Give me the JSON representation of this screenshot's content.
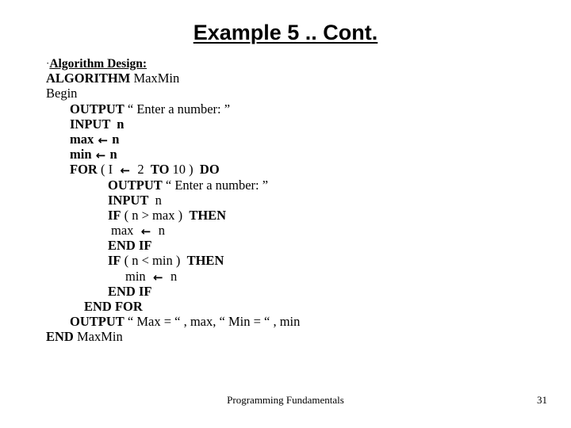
{
  "slide": {
    "title": "Example 5 .. Cont.",
    "background_color": "#ffffff",
    "text_color": "#000000"
  },
  "heading": {
    "bullet": "·",
    "label": "Algorithm Design:"
  },
  "algorithm": {
    "arrow_glyph": "←",
    "lines": [
      {
        "indent": 0,
        "kw1": "ALGORITHM",
        "plain1": " MaxMin"
      },
      {
        "indent": 0,
        "kw1": "",
        "plain1": "Begin"
      },
      {
        "indent": 1,
        "kw1": "OUTPUT",
        "plain1": " “ Enter a number: ”"
      },
      {
        "indent": 1,
        "kw1": "INPUT  n",
        "plain1": ""
      },
      {
        "indent": 1,
        "kw1": "max",
        "arrow": true,
        "kw2": "n"
      },
      {
        "indent": 1,
        "kw1": "min",
        "arrow": true,
        "kw2": "n"
      },
      {
        "indent": 1,
        "kw1": "FOR",
        "plain1": " ( I ",
        "arrow": true,
        "plain2": " 2  ",
        "kw2": "TO",
        "plain3": " 10 )  ",
        "kw3": "DO"
      },
      {
        "indent": 3,
        "kw1": "OUTPUT",
        "plain1": " “ Enter a number: ”"
      },
      {
        "indent": 3,
        "kw1": "INPUT",
        "plain1": "  n"
      },
      {
        "indent": 3,
        "kw1": "IF",
        "plain1": " ( n > max )  ",
        "kw2": "THEN"
      },
      {
        "indent": 4,
        "plain1": "max ",
        "arrow": true,
        "plain2": " n"
      },
      {
        "indent": 3,
        "kw1": "END IF",
        "plain1": ""
      },
      {
        "indent": 3,
        "kw1": "IF",
        "plain1": " ( n < min )  ",
        "kw2": "THEN"
      },
      {
        "indent": 5,
        "plain1": "min ",
        "arrow": true,
        "plain2": " n"
      },
      {
        "indent": 3,
        "kw1": "END IF",
        "plain1": ""
      },
      {
        "indent": 6,
        "kw1": "END FOR",
        "plain1": ""
      },
      {
        "indent": 1,
        "kw1": "OUTPUT",
        "plain1": " “ Max = “ , max, “ Min = “ , min"
      },
      {
        "indent": 0,
        "kw1": "END",
        "plain1": " MaxMin"
      }
    ]
  },
  "footer": {
    "course": "Programming Fundamentals",
    "page_number": "31"
  }
}
